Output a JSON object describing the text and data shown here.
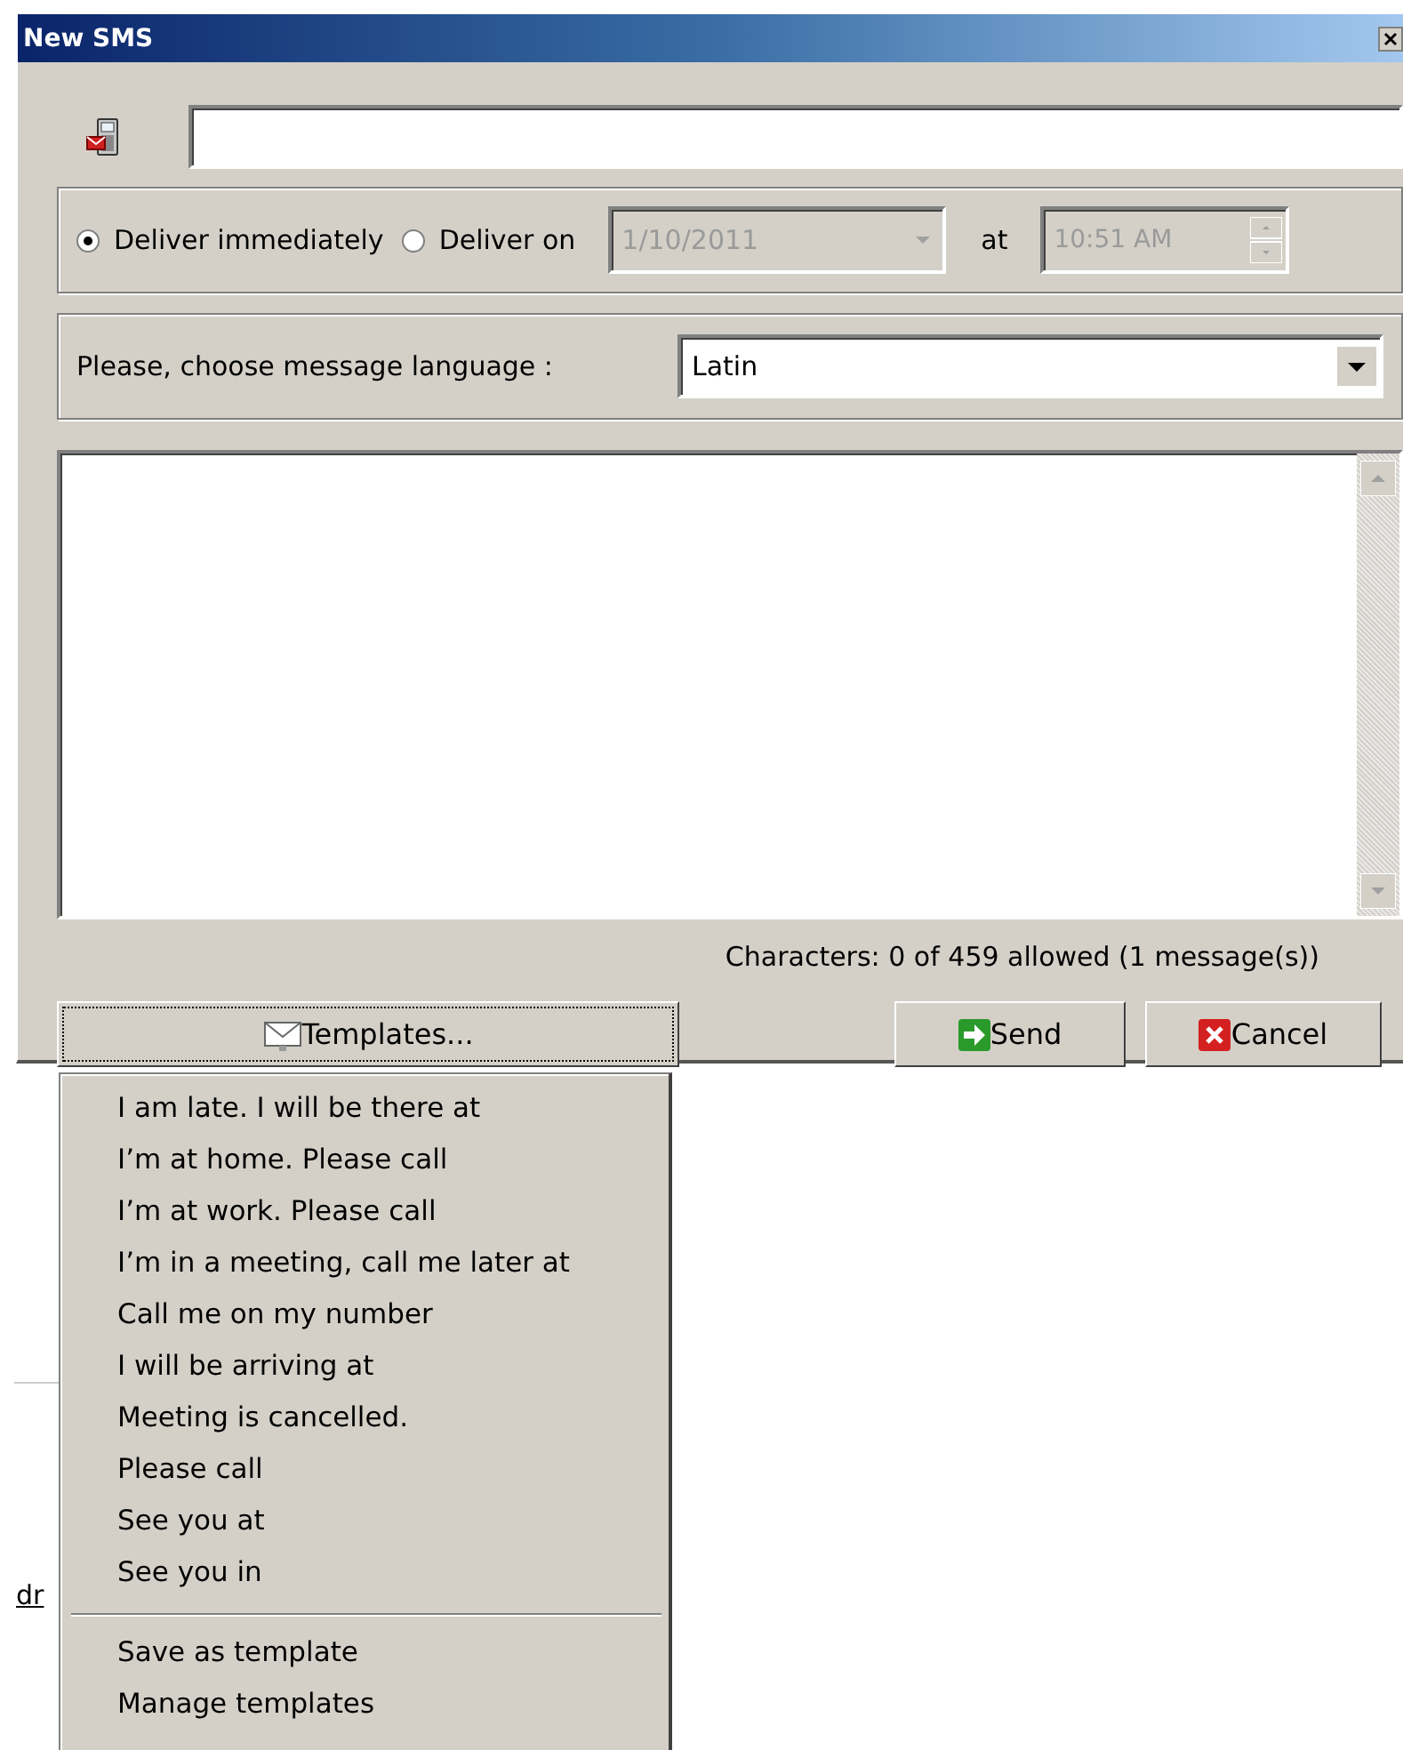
{
  "window": {
    "title": "New SMS"
  },
  "delivery": {
    "options": [
      {
        "label": "Deliver immediately",
        "selected": true
      },
      {
        "label": "Deliver on",
        "selected": false
      }
    ],
    "date": {
      "value": "1/10/2011",
      "disabled": true
    },
    "at_label": "at",
    "time": {
      "value": "10:51 AM",
      "disabled": true
    }
  },
  "language": {
    "label": "Please, choose message language :",
    "value": "Latin"
  },
  "counter": "Characters: 0 of 459 allowed (1 message(s))",
  "buttons": [
    {
      "kind": "templates",
      "label": "Templates...",
      "focused": true
    },
    {
      "kind": "send",
      "label": "Send",
      "focused": false
    },
    {
      "kind": "cancel",
      "label": "Cancel",
      "focused": false
    }
  ],
  "templates_menu": {
    "sections": [
      [
        "I am late. I will be there at",
        "I’m at home. Please call",
        "I’m at work. Please call",
        "I’m in a meeting, call me later at",
        "Call me on my number",
        "I will be arriving at",
        "Meeting is cancelled.",
        "Please call",
        "See you at",
        "See you in"
      ],
      [
        "Save as template",
        "Manage templates"
      ]
    ]
  },
  "background": {
    "link": "dr"
  }
}
